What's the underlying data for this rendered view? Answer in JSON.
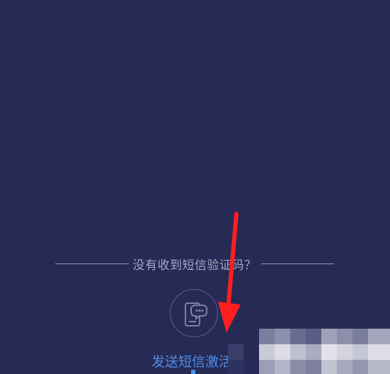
{
  "divider": {
    "text": "没有收到短信验证码？"
  },
  "sms_activation": {
    "label": "发送短信激活",
    "icon": "phone-message-icon"
  },
  "annotation": {
    "icon": "red-arrow-icon",
    "color": "#ff1f1f"
  },
  "colors": {
    "background": "#262a55",
    "accent": "#4f8fe6"
  }
}
